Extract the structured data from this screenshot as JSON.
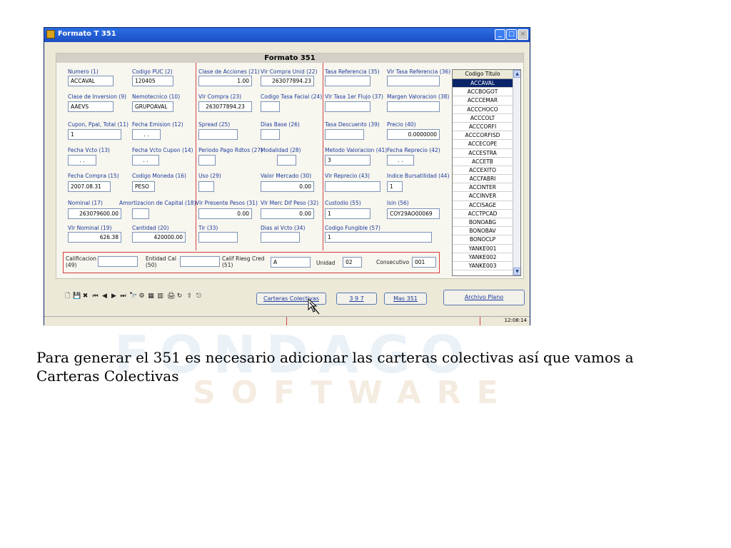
{
  "watermark": {
    "line1": "FONDAGO",
    "line2": "SOFTWARE"
  },
  "window": {
    "title": "Formato T 351",
    "min": "_",
    "max": "□",
    "close": "×"
  },
  "form": {
    "header": "Formato 351",
    "fields": [
      {
        "label": "Numero  (1)",
        "value": "ACCAVAL"
      },
      {
        "label": "Codigo PUC (2)",
        "value": "120405"
      },
      {
        "label": "Clase de Acciones (21)",
        "value": "1.00"
      },
      {
        "label": "Vlr Compra Unid (22)",
        "value": "263077894.23"
      },
      {
        "label": "Tasa Referencia (35)",
        "value": ""
      },
      {
        "label": "Vlr Tasa Referencia (36)",
        "value": ""
      },
      {
        "label": "Clase de Inversion (9)",
        "value": "AAEVS"
      },
      {
        "label": "Nemotecnico (10)",
        "value": "GRUPOAVAL"
      },
      {
        "label": "Vlr Compra (23)",
        "value": "263077894.23"
      },
      {
        "label": "Codigo Tasa Facial (24)",
        "value": ""
      },
      {
        "label": "Vlr Tasa 1er Flujo (37)",
        "value": ""
      },
      {
        "label": "Margen Valoracion (38)",
        "value": ""
      },
      {
        "label": "Cupon, Ppal, Total (11)",
        "value": "1"
      },
      {
        "label": "Fecha Emision (12)",
        "value": ". ."
      },
      {
        "label": "Spread (25)",
        "value": ""
      },
      {
        "label": "Dias Base (26)",
        "value": ""
      },
      {
        "label": "Tasa Descuento (39)",
        "value": ""
      },
      {
        "label": "Precio (40)",
        "value": "0.0000000"
      },
      {
        "label": "Fecha Vcto (13)",
        "value": ". ."
      },
      {
        "label": "Fecha Vcto Cupon (14)",
        "value": ". ."
      },
      {
        "label": "Periodo Pago Rdtos (27)",
        "value": ""
      },
      {
        "label": "Modalidad (28)",
        "value": ""
      },
      {
        "label": "Metodo Valoracion (41)",
        "value": "3"
      },
      {
        "label": "Fecha Reprecio (42)",
        "value": ". ."
      },
      {
        "label": "Fecha Compra (15)",
        "value": "2007.08.31"
      },
      {
        "label": "Codigo Moneda (16)",
        "value": "PESO"
      },
      {
        "label": "Uso (29)",
        "value": ""
      },
      {
        "label": "Valor Mercado (30)",
        "value": "0.00"
      },
      {
        "label": "Vlr Reprecio (43)",
        "value": ""
      },
      {
        "label": "Indice Bursatilidad (44)",
        "value": "1"
      },
      {
        "label": "Nominal (17)",
        "value": "263079600.00"
      },
      {
        "label": "Amortizacion de Capital (18)",
        "value": ""
      },
      {
        "label": "Vlr Presente Pesos (31)",
        "value": "0.00"
      },
      {
        "label": "Vlr Merc Dif Peso (32)",
        "value": "0.00"
      },
      {
        "label": "Custodio (55)",
        "value": "1"
      },
      {
        "label": "Isin (56)",
        "value": "COY29AO00069"
      },
      {
        "label": "Vlr Nominal (19)",
        "value": "626.38"
      },
      {
        "label": "Cantidad (20)",
        "value": "420000.00"
      },
      {
        "label": "Tir (33)",
        "value": ""
      },
      {
        "label": "Dias al Vcto (34)",
        "value": ""
      },
      {
        "label": "Codigo Fungible (57)",
        "value": "1"
      }
    ],
    "bottom": {
      "calificacion_label": "Calificacion (49)",
      "calificacion": "",
      "entidad_label": "Entidad Cal (50)",
      "entidad": "",
      "calif_riesg_label": "Calif Riesg Cred (51)",
      "calif_riesg": "A",
      "unidad_label": "Unidad",
      "unidad": "02",
      "consecutivo_label": "Consecutivo",
      "consecutivo": "001"
    }
  },
  "list": {
    "header": "Codigo Titulo",
    "items": [
      "ACCAVAL",
      "ACCBOGOT",
      "ACCCEMAR",
      "ACCCHOCO",
      "ACCCOLT",
      "ACCCORFI",
      "ACCCORFISD",
      "ACCECOPE",
      "ACCESTRA",
      "ACCETB",
      "ACCEXITO",
      "ACCFABRI",
      "ACCINTER",
      "ACCINVER",
      "ACCISAGE",
      "ACCTPCAD",
      "BONOABG",
      "BONOBAV",
      "BONOCLP",
      "YANKE001",
      "YANKE002",
      "YANKE003"
    ],
    "selected_index": 0
  },
  "toolbar": {
    "icons": [
      "new-icon",
      "save-icon",
      "delete-icon",
      "first-icon",
      "prev-icon",
      "next-icon",
      "last-icon",
      "find-icon",
      "filter-icon",
      "grid-icon",
      "chart-icon",
      "print-icon",
      "refresh-icon",
      "export-icon",
      "exit-icon"
    ],
    "glyphs": [
      "🗋",
      "💾",
      "✖",
      "⏮",
      "◀",
      "▶",
      "⏭",
      "🔭",
      "⚙",
      "▦",
      "▥",
      "🖨",
      "↻",
      "⇪",
      "⎋"
    ],
    "buttons": {
      "carteras": "Carteras Colectivas",
      "b397": "3 9 7",
      "mas351": "Mas 351",
      "archivo": "Archivo Plano"
    }
  },
  "status": {
    "time": "12:08:14"
  },
  "caption": "Para generar el 351 es necesario adicionar las carteras colectivas así que vamos a Carteras Colectivas"
}
